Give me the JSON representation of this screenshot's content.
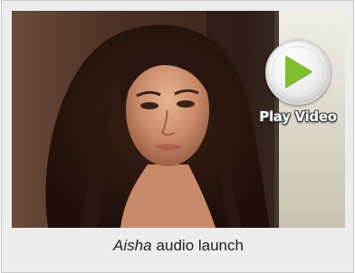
{
  "video": {
    "play_label": "Play Video",
    "play_color": "#7fbf2d"
  },
  "caption": {
    "title_italic": "Aisha",
    "title_rest": "audio launch"
  },
  "icons": {
    "play": "play-icon"
  }
}
